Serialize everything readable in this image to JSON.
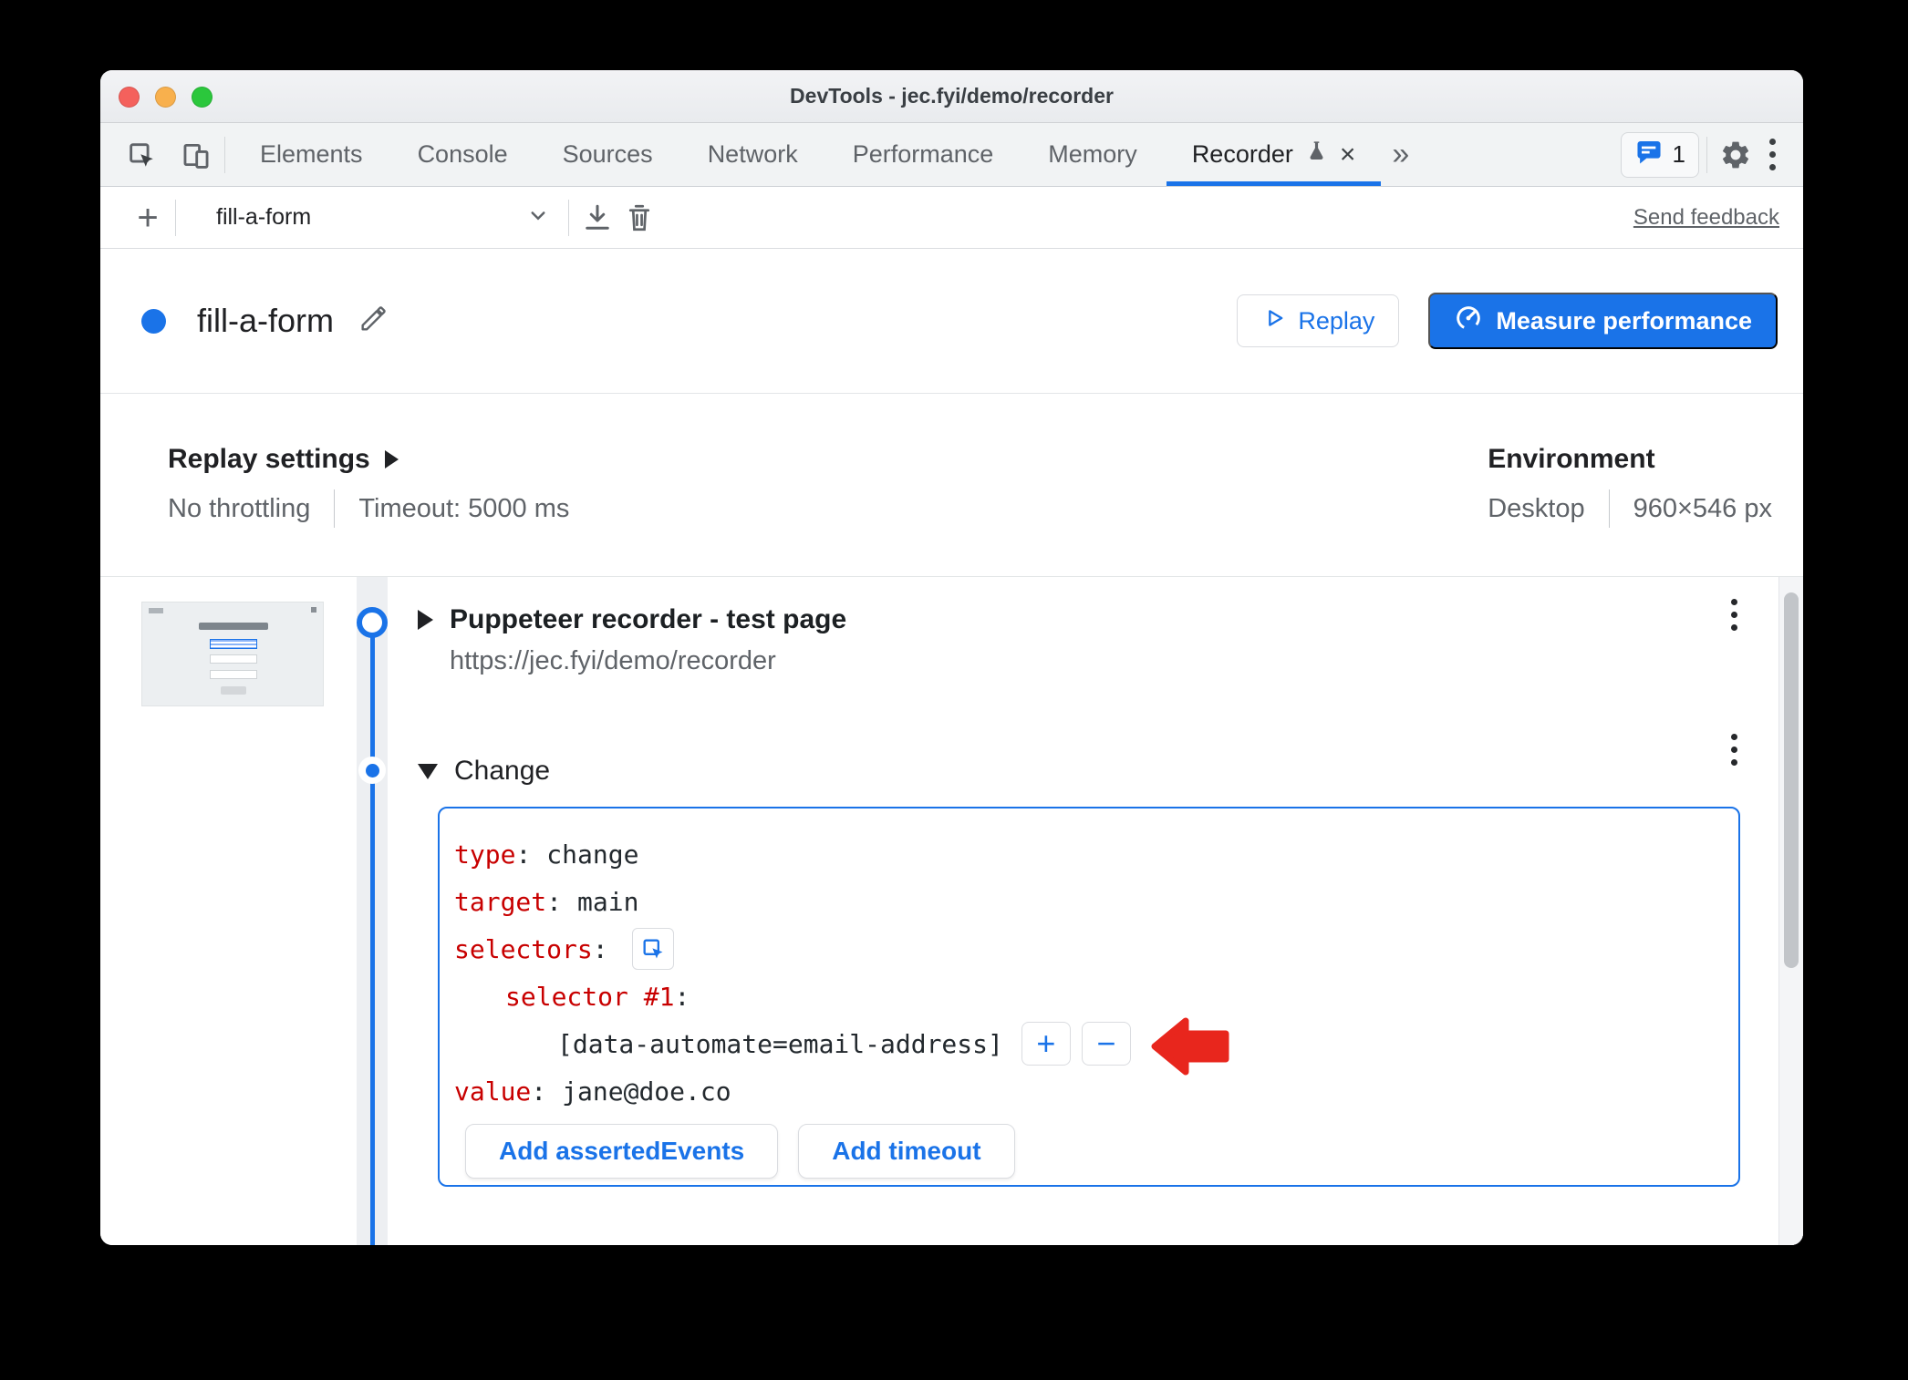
{
  "window": {
    "title": "DevTools - jec.fyi/demo/recorder"
  },
  "tab_bar": {
    "tabs": [
      {
        "label": "Elements"
      },
      {
        "label": "Console"
      },
      {
        "label": "Sources"
      },
      {
        "label": "Network"
      },
      {
        "label": "Performance"
      },
      {
        "label": "Memory"
      },
      {
        "label": "Recorder"
      }
    ],
    "active_tab": "Recorder",
    "issues_count": "1"
  },
  "recorder_toolbar": {
    "recording_select": "fill-a-form",
    "send_feedback_label": "Send feedback"
  },
  "recording_header": {
    "title": "fill-a-form",
    "replay_label": "Replay",
    "measure_label": "Measure performance"
  },
  "settings": {
    "replay_settings_label": "Replay settings",
    "throttling": "No throttling",
    "timeout": "Timeout: 5000 ms",
    "environment_label": "Environment",
    "device": "Desktop",
    "viewport": "960×546 px"
  },
  "steps": {
    "navigate": {
      "title": "Puppeteer recorder - test page",
      "url": "https://jec.fyi/demo/recorder"
    },
    "change": {
      "title": "Change",
      "rows": [
        {
          "key": "type",
          "value": "change"
        },
        {
          "key": "target",
          "value": "main"
        },
        {
          "key": "selectors",
          "value": ""
        },
        {
          "key": "selector #1",
          "value": ""
        },
        {
          "key": "",
          "value": "[data-automate=email-address]"
        },
        {
          "key": "value",
          "value": "jane@doe.co"
        }
      ],
      "add_asserted_events_label": "Add assertedEvents",
      "add_timeout_label": "Add timeout"
    }
  },
  "glyphs": {
    "colon": ":",
    "plus": "+",
    "minus": "−",
    "close": "×",
    "more_tabs": "»"
  },
  "colors": {
    "accent_blue": "#1a73e8",
    "code_key_red": "#c80000",
    "arrow_red": "#e8261d"
  }
}
